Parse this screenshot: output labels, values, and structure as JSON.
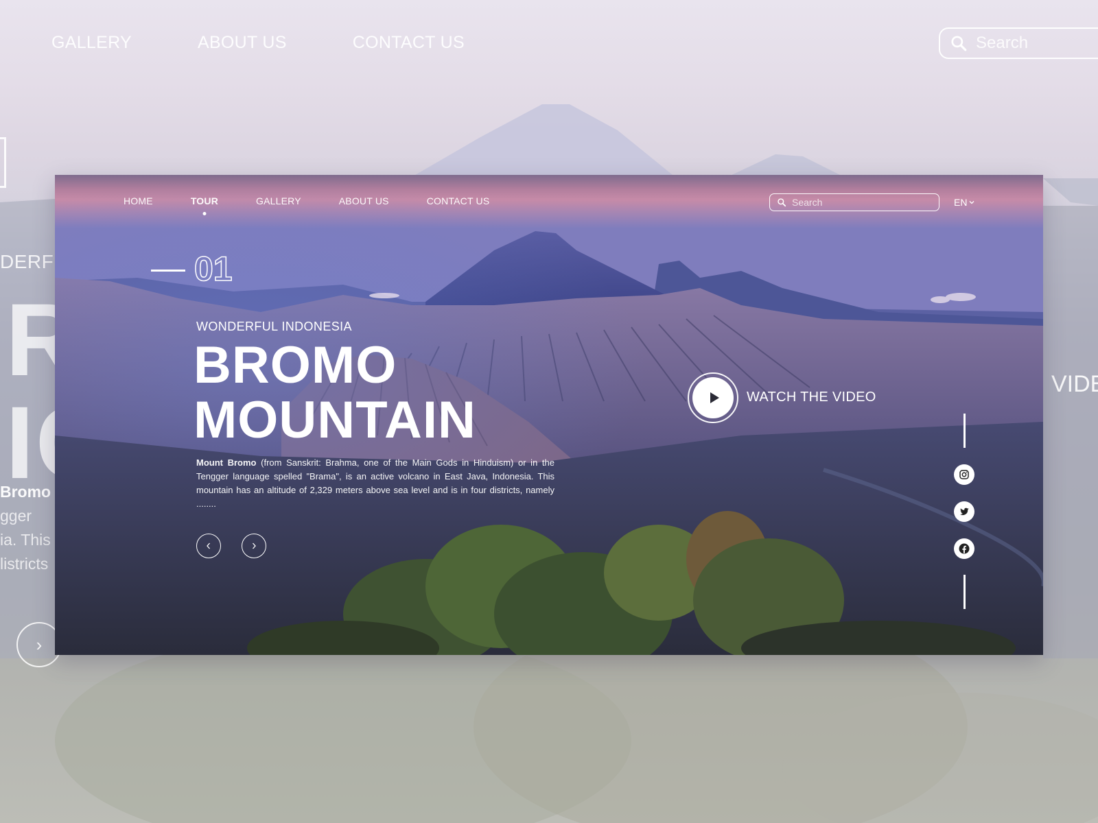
{
  "background": {
    "nav": [
      "GALLERY",
      "ABOUT US",
      "CONTACT US"
    ],
    "search_placeholder": "Search",
    "subtitle_fragment": "DERF",
    "title_fragment_1": "R",
    "title_fragment_2": "IC",
    "desc_fragment_bold": "Bromo",
    "desc_fragment_lines": [
      "gger",
      "ia. This",
      "listricts"
    ],
    "video_fragment": "VIDE"
  },
  "nav": {
    "items": [
      {
        "label": "HOME",
        "active": false
      },
      {
        "label": "TOUR",
        "active": true
      },
      {
        "label": "GALLERY",
        "active": false
      },
      {
        "label": "ABOUT US",
        "active": false
      },
      {
        "label": "CONTACT US",
        "active": false
      }
    ]
  },
  "search": {
    "placeholder": "Search"
  },
  "language": {
    "selected": "EN"
  },
  "slide": {
    "number": "01",
    "eyebrow": "WONDERFUL INDONESIA",
    "title_line_1": "BROMO",
    "title_line_2": "MOUNTAIN",
    "description_bold": "Mount Bromo",
    "description": " (from Sanskrit: Brahma, one of the Main Gods in Hinduism) or in the Tengger language spelled \"Brama\", is an active volcano in East Java, Indonesia. This mountain has an altitude of 2,329 meters above sea level and is in four districts, namely ........"
  },
  "video": {
    "label": "WATCH THE VIDEO"
  },
  "social": [
    "instagram-icon",
    "twitter-icon",
    "facebook-icon"
  ],
  "colors": {
    "accent": "#ffffff",
    "sky_pink": "#c889a6",
    "sky_purple": "#6f6db0",
    "ground_dark": "#2d3034"
  }
}
